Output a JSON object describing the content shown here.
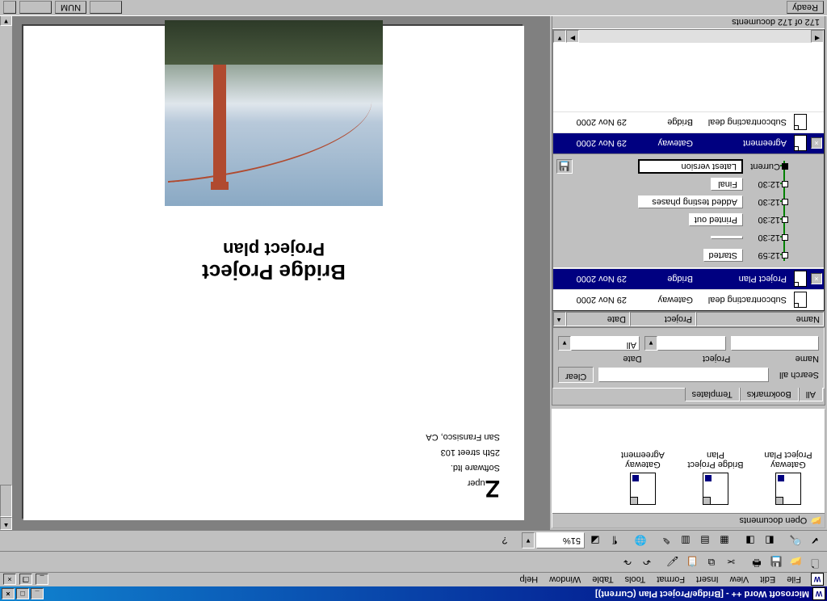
{
  "window": {
    "title": "Microsoft Word ++ - [Bridge/Project Plan (Current)]"
  },
  "menus": [
    "File",
    "Edit",
    "View",
    "Insert",
    "Format",
    "Tools",
    "Table",
    "Window",
    "Help"
  ],
  "zoom": "51%",
  "open_documents": {
    "header": "Open documents",
    "items": [
      {
        "label": "Gateway\nProject Plan"
      },
      {
        "label": "Bridge Project\nPlan"
      },
      {
        "label": "Gateway\nAgreement"
      }
    ]
  },
  "search": {
    "tabs": [
      "All",
      "Bookmarks",
      "Templates"
    ],
    "active_tab": 0,
    "search_label": "Search all",
    "clear_label": "Clear",
    "fields": {
      "name_label": "Name",
      "project_label": "Project",
      "date_label": "Date",
      "date_value": "All"
    },
    "columns": {
      "name": "Name",
      "project": "Project",
      "date": "Date"
    },
    "col_widths": {
      "name": 130,
      "project": 80,
      "date": 90
    }
  },
  "doc_rows": [
    {
      "name": "Subcontracting deal",
      "project": "Gateway",
      "date": "29 Nov 2000",
      "x": false
    },
    {
      "name": "Project Plan",
      "project": "Bridge",
      "date": "29 Nov 2000",
      "x": true,
      "selected": true,
      "expanded": true
    },
    {
      "name": "Agreement",
      "project": "Gateway",
      "date": "29 Nov 2000",
      "x": true
    },
    {
      "name": "Subcontracting deal",
      "project": "Bridge",
      "date": "29 Nov 2000",
      "x": false
    }
  ],
  "versions": [
    {
      "time": "12:59",
      "label": "Started"
    },
    {
      "time": "12:30",
      "label": ""
    },
    {
      "time": "12:30",
      "label": "Printed out"
    },
    {
      "time": "12:30",
      "label": "Added testing phases"
    },
    {
      "time": "12:30",
      "label": "Final"
    },
    {
      "time": "Current",
      "label": "Latest version",
      "current": true
    }
  ],
  "doc_count": "172 of 172 documents",
  "page_content": {
    "company1": "uper",
    "company2": "Software ltd.",
    "addr1": "25th street 103",
    "addr2": "San Fransisco, CA",
    "title1": "Bridge Project",
    "title2": "Project plan"
  },
  "status": {
    "ready": "Ready",
    "num": "NUM"
  }
}
